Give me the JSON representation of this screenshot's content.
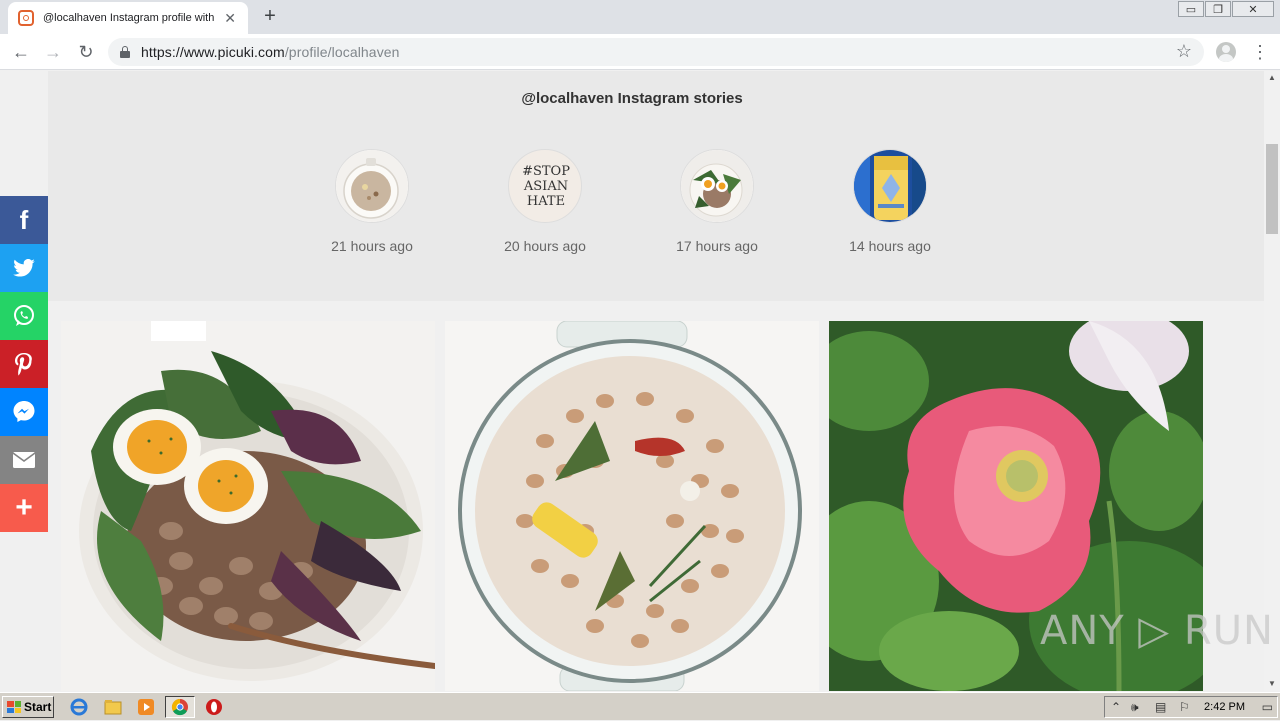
{
  "browser": {
    "tab_title": "@localhaven Instagram profile with posts and stories - Picuki.com",
    "tab_close": "✕",
    "new_tab": "+",
    "url_host": "https://www.picuki.com",
    "url_path": "/profile/localhaven",
    "nav": {
      "back": "←",
      "forward": "→",
      "reload": "↻"
    },
    "bookmark_icon": "☆",
    "menu_icon": "⋮",
    "window_controls": [
      "▭",
      "❐",
      "✕"
    ]
  },
  "stories": {
    "title": "@localhaven Instagram stories",
    "items": [
      {
        "time": "21 hours ago",
        "thumb": "soup-pot"
      },
      {
        "time": "20 hours ago",
        "thumb": "stop-asian-hate",
        "text": "#STOP ASIAN HATE"
      },
      {
        "time": "17 hours ago",
        "thumb": "bean-salad"
      },
      {
        "time": "14 hours ago",
        "thumb": "drink-can"
      }
    ]
  },
  "posts": [
    {
      "subject": "bean-salad-bowl"
    },
    {
      "subject": "beans-pot"
    },
    {
      "subject": "pink-poppy"
    }
  ],
  "share": [
    {
      "name": "facebook",
      "glyph": "f",
      "color": "#3b5998"
    },
    {
      "name": "twitter",
      "glyph": "🐦",
      "color": "#1da1f2"
    },
    {
      "name": "whatsapp",
      "glyph": "✆",
      "color": "#25d366"
    },
    {
      "name": "pinterest",
      "glyph": "P",
      "color": "#cb2027"
    },
    {
      "name": "messenger",
      "glyph": "✉",
      "color": "#0084ff"
    },
    {
      "name": "email",
      "glyph": "✉",
      "color": "#848484"
    },
    {
      "name": "more",
      "glyph": "+",
      "color": "#f75b4c"
    }
  ],
  "taskbar": {
    "start": "Start",
    "clock": "2:42 PM"
  },
  "watermark": "ANY ▷ RUN"
}
